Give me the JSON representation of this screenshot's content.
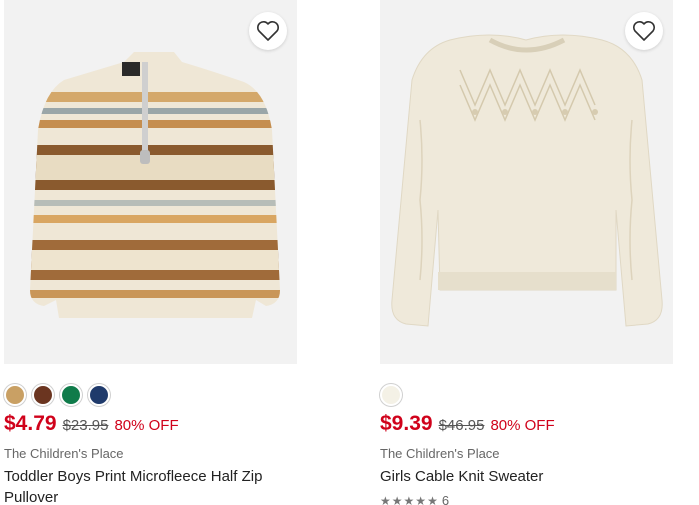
{
  "products": [
    {
      "image_alt": "Toddler Boys Print Microfleece Half Zip Pullover",
      "favorite_icon": "heart-outline-icon",
      "swatches": [
        "#c9a064",
        "#6b3520",
        "#0f7b4a",
        "#1f3a6b"
      ],
      "price": "$4.79",
      "original_price": "$23.95",
      "discount": "80% OFF",
      "brand": "The Children's Place",
      "title": "Toddler Boys Print Microfleece Half Zip Pullover"
    },
    {
      "image_alt": "Girls Cable Knit Sweater",
      "favorite_icon": "heart-outline-icon",
      "swatches": [
        "#f4f1e6"
      ],
      "price": "$9.39",
      "original_price": "$46.95",
      "discount": "80% OFF",
      "brand": "The Children's Place",
      "title": "Girls Cable Knit Sweater",
      "rating": {
        "stars": 5,
        "count": "6"
      }
    }
  ]
}
